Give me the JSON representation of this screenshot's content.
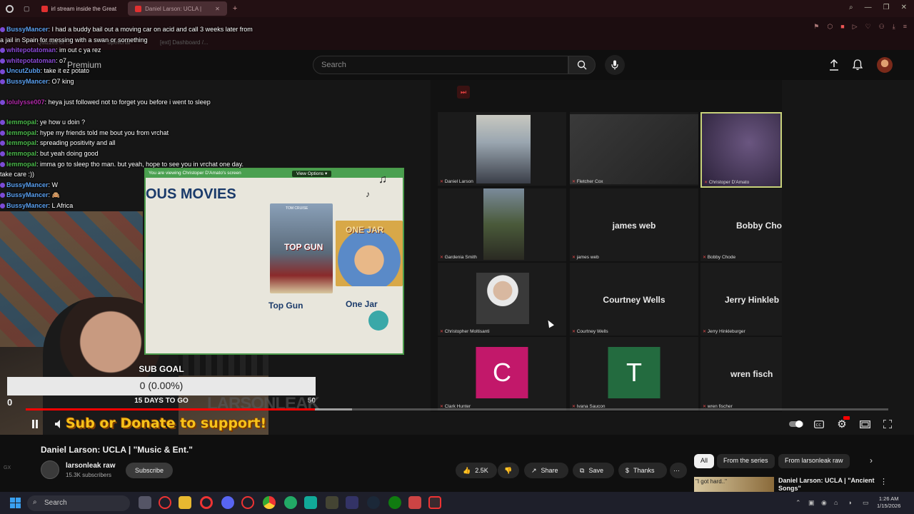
{
  "browser": {
    "tabs": [
      {
        "label": "irl stream inside the Great",
        "active": false
      },
      {
        "label": "Daniel Larson: UCLA |",
        "active": true
      }
    ],
    "new_tab_glyph": "+",
    "bookmarks_faint": [
      "Quizzes of ...",
      "Spellchar",
      "[ext] Dashboard /..."
    ]
  },
  "header": {
    "brand": "Premium",
    "search_placeholder": "Search",
    "icons": [
      "upload-icon",
      "bell-icon",
      "avatar"
    ]
  },
  "chat": [
    {
      "user": "BussyMancer",
      "color": "#5aa0f0",
      "text": "I had a buddy bail out a moving car on acid and call 3 weeks later from a jail in Spain for messing with a swan or something",
      "wrap": true
    },
    {
      "user": "whitepotatoman",
      "color": "#8a4ad6",
      "text": "im out c ya rez"
    },
    {
      "user": "whitepotatoman",
      "color": "#8a4ad6",
      "text": "o7"
    },
    {
      "user": "UncutZubb",
      "color": "#5aa0f0",
      "text": "take it ez potato"
    },
    {
      "user": "BussyMancer",
      "color": "#5aa0f0",
      "text": "O7 king"
    },
    {
      "user": "lolulysse007",
      "color": "#b02aa8",
      "text": "heya just followed not to forget you before i went to sleep",
      "gap": true
    },
    {
      "user": "lemmopal",
      "color": "#4ab84a",
      "text": "ye how u doin ?",
      "gap": true
    },
    {
      "user": "lemmopal",
      "color": "#4ab84a",
      "text": "hype my friends told me bout you from vrchat"
    },
    {
      "user": "lemmopal",
      "color": "#4ab84a",
      "text": "spreading positivity and all"
    },
    {
      "user": "lemmopal",
      "color": "#4ab84a",
      "text": "but yeah doing good"
    },
    {
      "user": "lemmopal",
      "color": "#4ab84a",
      "text": "imma go to sleep tho man. but yeah, hope to see you in vrchat one day. take care :))",
      "wrap": true
    },
    {
      "user": "BussyMancer",
      "color": "#5aa0f0",
      "text": "W"
    },
    {
      "user": "BussyMancer",
      "color": "#5aa0f0",
      "text": "🙈"
    },
    {
      "user": "BussyMancer",
      "color": "#5aa0f0",
      "text": "L Africa"
    }
  ],
  "screenshare": {
    "banner": "You are viewing  Christoper D'Amato's screen",
    "view_options": "View Options ▾",
    "heading": "OUS MOVIES",
    "movies": [
      {
        "poster_text": "TOM CRUISE",
        "title_on_poster": "TOP GUN",
        "caption": "Top Gun"
      },
      {
        "poster_text": "ONE JAR",
        "caption": "One Jar"
      }
    ]
  },
  "zoom": {
    "participants": [
      {
        "name": "Daniel Larson",
        "type": "video",
        "muted_pin": true
      },
      {
        "name": "Fletcher Cox",
        "type": "video-dark"
      },
      {
        "name": "Christoper D'Amato",
        "type": "video-purple",
        "active_speaker": true
      },
      {
        "name": "Gardenia Smith",
        "type": "video"
      },
      {
        "name": "james web",
        "type": "name",
        "display": "james web"
      },
      {
        "name": "Bobby Chode",
        "type": "name",
        "display": "Bobby Cho"
      },
      {
        "name": "Christopher Moltisanti",
        "type": "video"
      },
      {
        "name": "Courtney Wells",
        "type": "name",
        "display": "Courtney Wells"
      },
      {
        "name": "Jerry Hinkleburger",
        "type": "name",
        "display": "Jerry Hinkleb"
      },
      {
        "name": "Clark Hunter",
        "type": "letter",
        "display": "C",
        "color": "#c2186a"
      },
      {
        "name": "Ivana Saucon",
        "type": "letter",
        "display": "T",
        "color": "#236b3f"
      },
      {
        "name": "wren fischer",
        "type": "name",
        "display": "wren fisch"
      }
    ]
  },
  "sub_goal": {
    "title": "SUB GOAL",
    "value_text": "0 (0.00%)",
    "min": "0",
    "days": "15 DAYS TO GO",
    "max": "50",
    "progress": 0
  },
  "overlay": {
    "watermark": "LARSONLEAK",
    "donate": "Sub or Donate to support!"
  },
  "player": {
    "played_fraction": 0.335,
    "loaded_fraction": 0.378
  },
  "video": {
    "title": "Daniel Larson: UCLA | \"Music & Ent.\"",
    "channel": "larsonleak raw",
    "subscribers": "15.3K subscribers",
    "subscribe": "Subscribe",
    "likes": "2.5K",
    "share": "Share",
    "save": "Save",
    "thanks": "Thanks",
    "more": "···"
  },
  "chips": [
    "All",
    "From the series",
    "From larsonleak raw"
  ],
  "recommended": {
    "thumb_text": "\"I got hard..\"",
    "title": "Daniel Larson: UCLA | \"Ancient Songs\""
  },
  "taskbar": {
    "search": "Search",
    "time": "1:26 AM",
    "date": "1/15/2026"
  },
  "left_rail": [
    "GX"
  ],
  "colors": {
    "accent": "#ff0000",
    "sub_goal_text": "#f7c21a",
    "browser_bar": "#231013"
  }
}
